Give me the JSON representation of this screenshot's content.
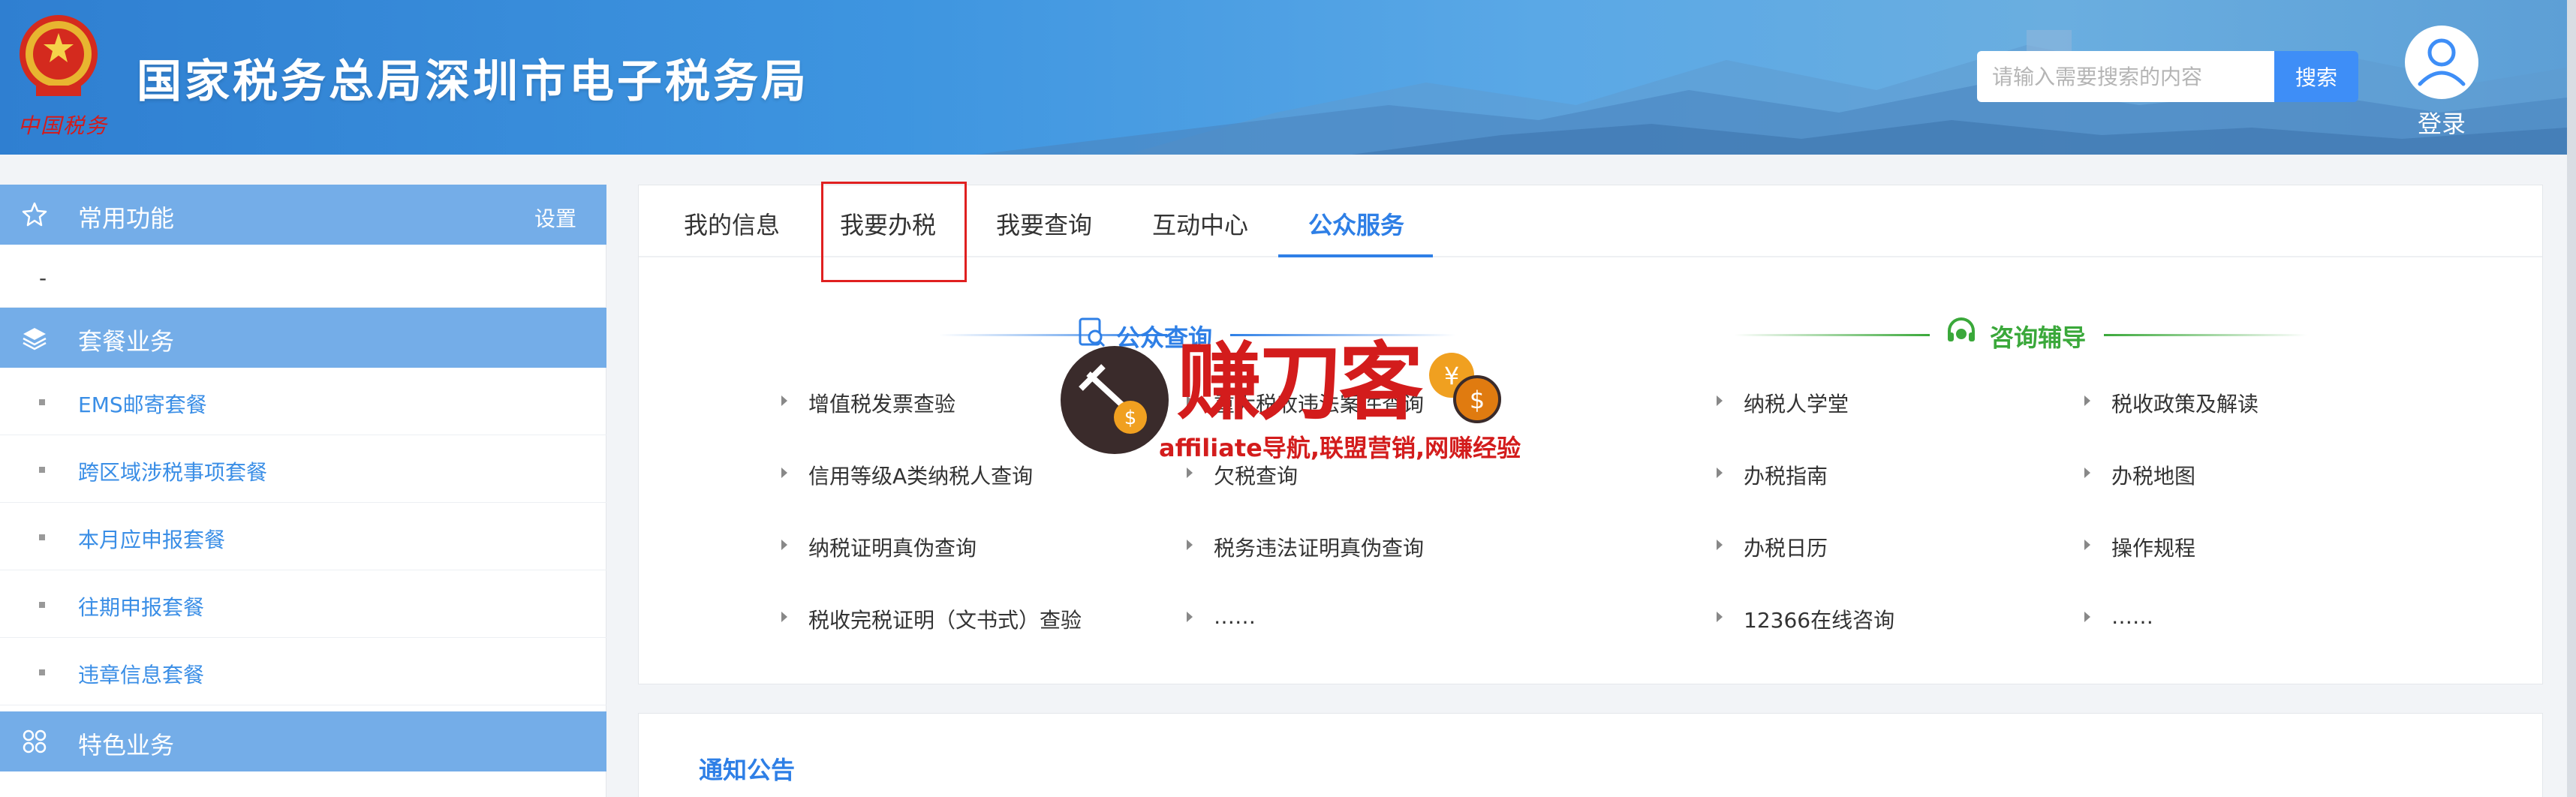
{
  "header": {
    "brand_sub": "中国税务",
    "site_title": "国家税务总局深圳市电子税务局",
    "search_placeholder": "请输入需要搜索的内容",
    "search_button": "搜索",
    "login_label": "登录"
  },
  "sidebar": {
    "common": {
      "label": "常用功能",
      "settings": "设置",
      "empty_marker": "-"
    },
    "package": {
      "label": "套餐业务",
      "items": [
        "EMS邮寄套餐",
        "跨区域涉税事项套餐",
        "本月应申报套餐",
        "往期申报套餐",
        "违章信息套餐"
      ]
    },
    "special": {
      "label": "特色业务"
    }
  },
  "tabs": {
    "items": [
      "我的信息",
      "我要办税",
      "我要查询",
      "互动中心",
      "公众服务"
    ],
    "active": "公众服务"
  },
  "sections": {
    "public_query": {
      "title": "公众查询",
      "col1": [
        "增值税发票查验",
        "信用等级A类纳税人查询",
        "纳税证明真伪查询",
        "税收完税证明（文书式）查验"
      ],
      "col2": [
        "重大税收违法案件查询",
        "欠税查询",
        "税务违法证明真伪查询",
        "……"
      ]
    },
    "consult": {
      "title": "咨询辅导",
      "col1": [
        "纳税人学堂",
        "办税指南",
        "办税日历",
        "12366在线咨询"
      ],
      "col2": [
        "税收政策及解读",
        "办税地图",
        "操作规程",
        "……"
      ]
    }
  },
  "notice": {
    "title": "通知公告"
  },
  "watermark": {
    "title": "赚刀客",
    "subtitle": "affiliate导航,联盟营销,网赚经验"
  },
  "colors": {
    "header_blue": "#3e95e0",
    "sidebar_head": "#74ade8",
    "accent_blue": "#2e7fe6",
    "link_blue": "#3a8ee6",
    "consult_green": "#3aa83a",
    "highlight_red": "#e02020",
    "watermark_red": "#d31c1c"
  }
}
